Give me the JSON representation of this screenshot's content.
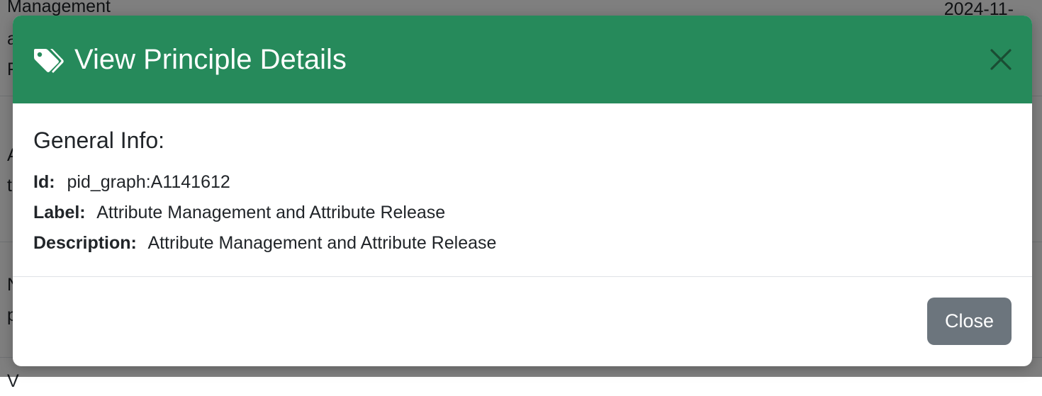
{
  "background": {
    "rows": [
      {
        "lines": [
          "Management",
          "a",
          "F"
        ],
        "date": "2024-11-"
      },
      {
        "lines": [
          "A",
          "t"
        ]
      },
      {
        "lines": [
          "N",
          "p"
        ]
      },
      {
        "lines": [
          "V"
        ]
      }
    ]
  },
  "modal": {
    "icon": "tags-icon",
    "title": "View Principle Details",
    "close_icon": "close-icon",
    "section_title": "General Info:",
    "fields": [
      {
        "key": "Id:",
        "value": "pid_graph:A1141612"
      },
      {
        "key": "Label:",
        "value": "Attribute Management and Attribute Release"
      },
      {
        "key": "Description:",
        "value": "Attribute Management and Attribute Release"
      }
    ],
    "close_button_label": "Close"
  },
  "colors": {
    "header": "#268a5b",
    "close_button": "#6c757d",
    "close_x": "#1a4d33"
  }
}
